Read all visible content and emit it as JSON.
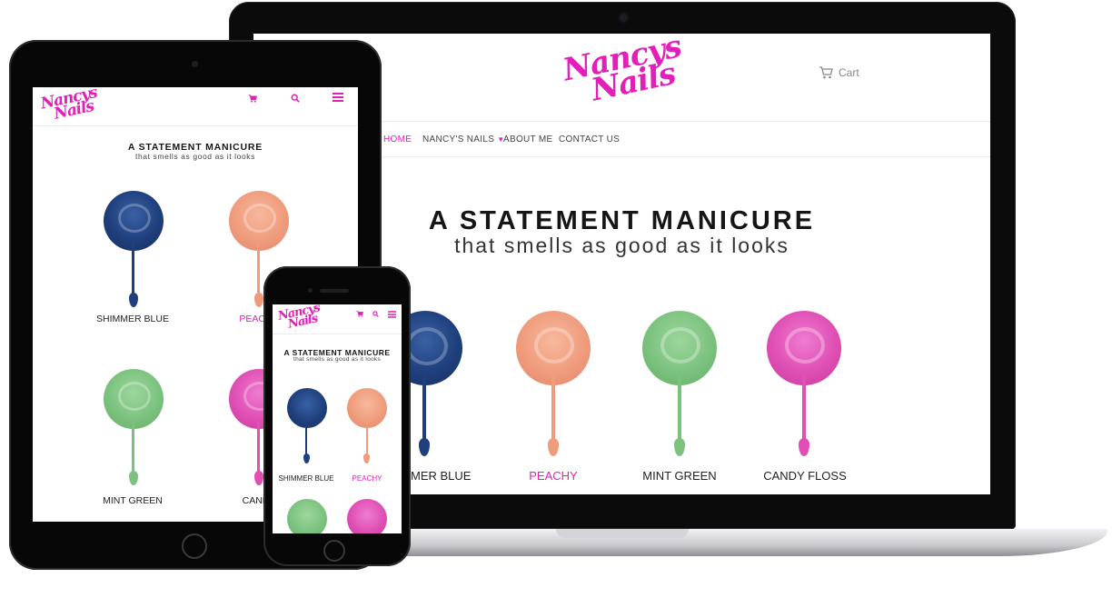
{
  "brand": {
    "logo_line1": "Nancys",
    "logo_line2": "Nails",
    "accent_color": "#e31fb9"
  },
  "laptop": {
    "cart_label": "Cart",
    "nav": [
      {
        "label": "HOME",
        "active": true
      },
      {
        "label": "NANCY'S NAILS",
        "has_dropdown": true,
        "icon": "chevron-down-icon"
      },
      {
        "label": "ABOUT ME"
      },
      {
        "label": "CONTACT US"
      }
    ],
    "hero_title": "A STATEMENT MANICURE",
    "hero_subtitle": "that smells as good as it looks",
    "products": [
      {
        "label": "SHIMMER BLUE",
        "color": "#1f3f7c"
      },
      {
        "label": "PEACHY",
        "color": "#ef9c7c",
        "highlight": true
      },
      {
        "label": "MINT GREEN",
        "color": "#7cc27f"
      },
      {
        "label": "CANDY FLOSS",
        "color": "#df4fb4"
      }
    ]
  },
  "tablet": {
    "icons": [
      "cart-icon",
      "search-icon",
      "menu-icon"
    ],
    "hero_title": "A STATEMENT MANICURE",
    "hero_subtitle": "that smells as good as it looks",
    "products": [
      {
        "label": "SHIMMER BLUE"
      },
      {
        "label": "PEACHY"
      },
      {
        "label": "MINT GREEN"
      },
      {
        "label": "CANDY"
      }
    ]
  },
  "phone": {
    "icons": [
      "cart-icon",
      "search-icon",
      "menu-icon"
    ],
    "hero_title": "A STATEMENT MANICURE",
    "hero_subtitle": "that smells as good as it looks",
    "products": [
      {
        "label": "SHIMMER BLUE"
      },
      {
        "label": "PEACHY"
      }
    ]
  }
}
